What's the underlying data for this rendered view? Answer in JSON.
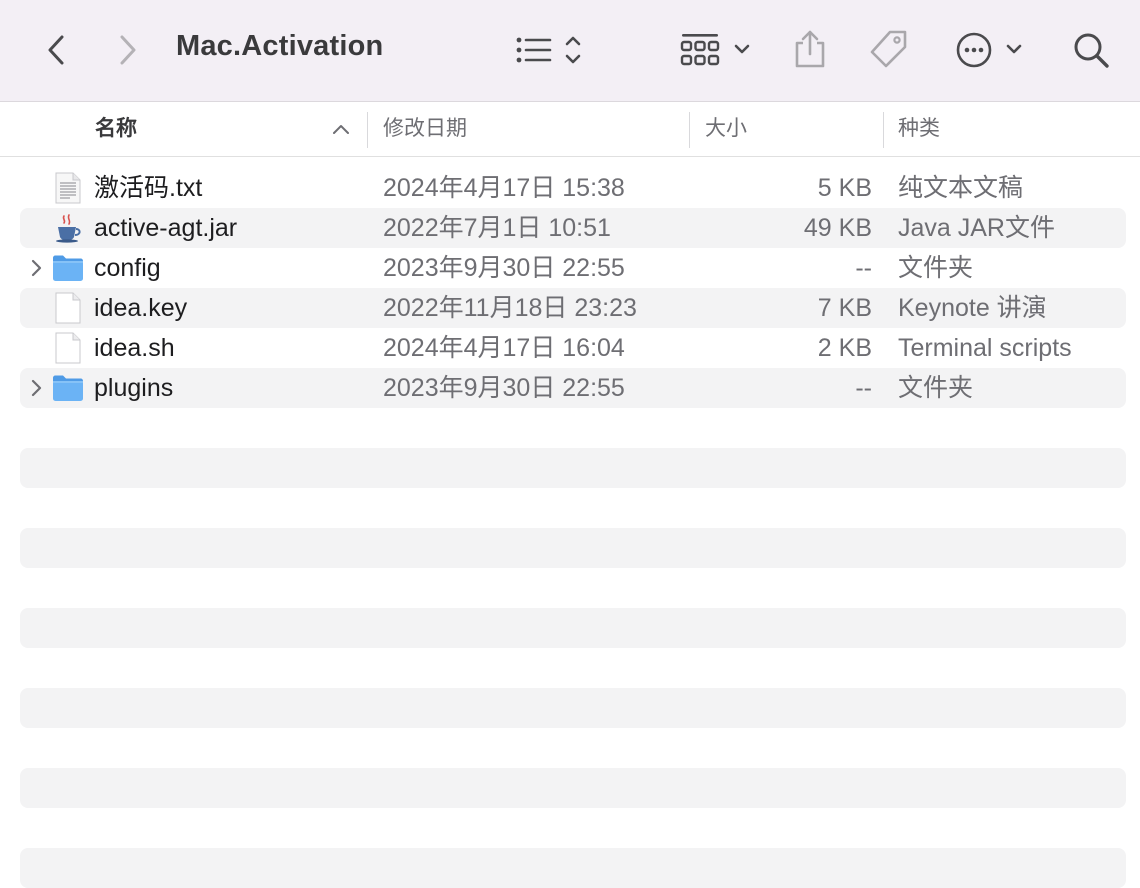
{
  "window": {
    "title": "Mac.Activation"
  },
  "toolbar": {
    "back_icon": "chevron-left-icon",
    "forward_icon": "chevron-right-icon",
    "view_icon": "list-view-icon",
    "group_icon": "grid-group-icon",
    "share_icon": "share-icon",
    "tag_icon": "tag-icon",
    "more_icon": "ellipsis-circle-icon",
    "search_icon": "search-icon"
  },
  "columns": {
    "name": "名称",
    "date": "修改日期",
    "size": "大小",
    "kind": "种类"
  },
  "files": [
    {
      "name": "激活码.txt",
      "date": "2024年4月17日 15:38",
      "size": "5 KB",
      "kind": "纯文本文稿",
      "icon": "text-file-icon"
    },
    {
      "name": "active-agt.jar",
      "date": "2022年7月1日 10:51",
      "size": "49 KB",
      "kind": "Java JAR文件",
      "icon": "java-coffee-icon"
    },
    {
      "name": "config",
      "date": "2023年9月30日 22:55",
      "size": "--",
      "kind": "文件夹",
      "icon": "folder-icon"
    },
    {
      "name": "idea.key",
      "date": "2022年11月18日 23:23",
      "size": "7 KB",
      "kind": "Keynote 讲演",
      "icon": "document-icon"
    },
    {
      "name": "idea.sh",
      "date": "2024年4月17日 16:04",
      "size": "2 KB",
      "kind": "Terminal scripts",
      "icon": "document-icon"
    },
    {
      "name": "plugins",
      "date": "2023年9月30日 22:55",
      "size": "--",
      "kind": "文件夹",
      "icon": "folder-icon"
    }
  ],
  "colors": {
    "toolbar_bg": "#f3eff5",
    "stripe": "#f3f3f4",
    "folder_blue": "#5aaaf0"
  }
}
